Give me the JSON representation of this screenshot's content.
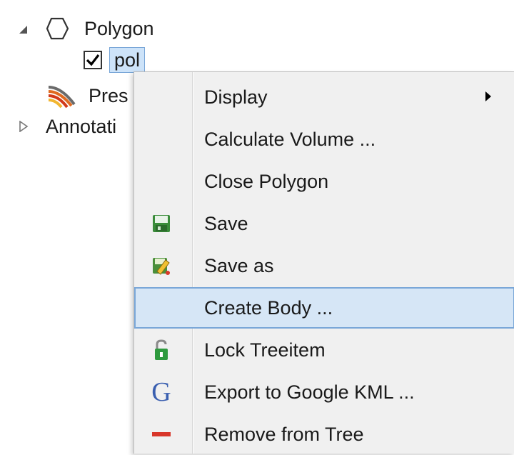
{
  "tree": {
    "polygon_label": "Polygon",
    "pol_label": "pol",
    "pres_label": "Pres",
    "annotation_label": "Annotati"
  },
  "menu": {
    "items": [
      {
        "label": "Display",
        "icon": "none",
        "submenu": true
      },
      {
        "label": "Calculate Volume ...",
        "icon": "none"
      },
      {
        "label": "Close Polygon",
        "icon": "none"
      },
      {
        "label": "Save",
        "icon": "save-icon"
      },
      {
        "label": "Save as",
        "icon": "save-as-icon"
      },
      {
        "label": "Create Body ...",
        "icon": "none",
        "highlighted": true
      },
      {
        "label": "Lock Treeitem",
        "icon": "lock-icon"
      },
      {
        "label": "Export to Google KML ...",
        "icon": "google-g-icon"
      },
      {
        "label": "Remove from Tree",
        "icon": "remove-icon"
      }
    ]
  },
  "colors": {
    "highlight_bg": "#d6e6f6",
    "highlight_border": "#7aa7d8",
    "menu_bg": "#f0f0f0",
    "selection_bg": "#cde3f9"
  }
}
